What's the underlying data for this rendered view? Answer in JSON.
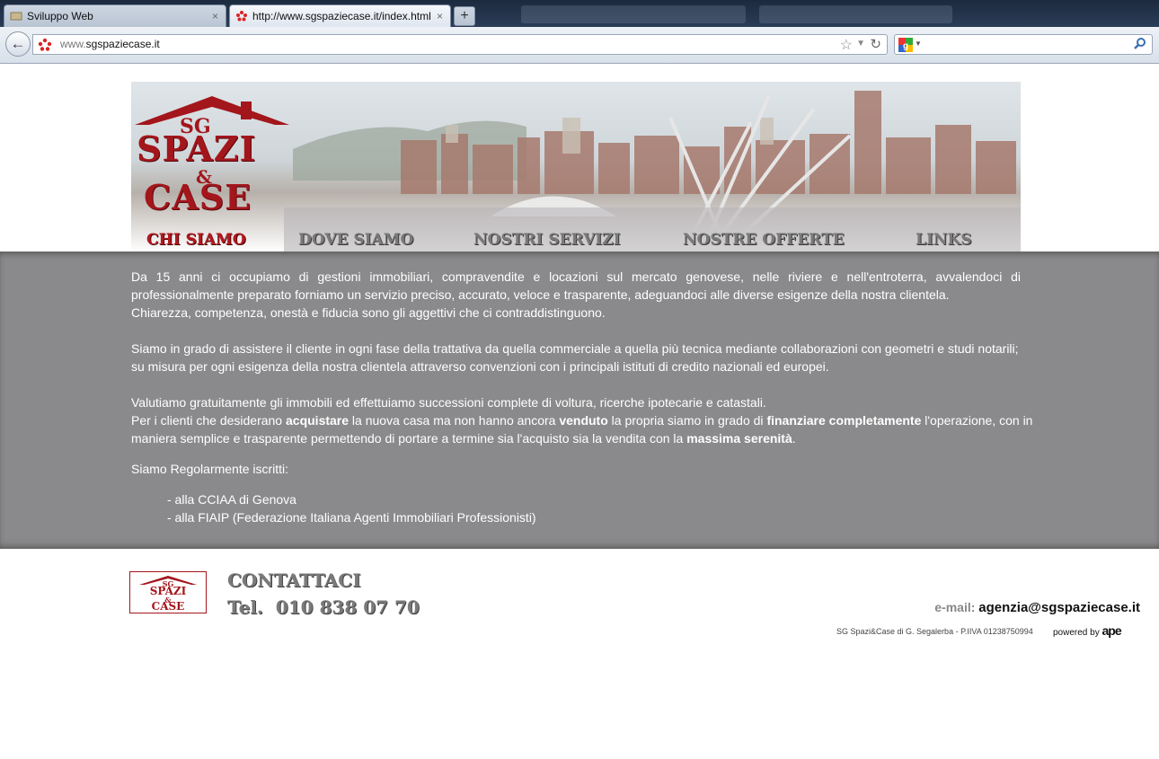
{
  "browser": {
    "tabs": [
      {
        "title": "Sviluppo Web",
        "active": false
      },
      {
        "title": "http://www.sgspaziecase.it/index.html",
        "active": true
      }
    ],
    "new_tab": "+",
    "close_glyph": "×",
    "url_prefix": "www.",
    "url_host": "sgspaziecase.it",
    "search_placeholder": ""
  },
  "header": {
    "logo": {
      "sg": "SG",
      "spazi": "SPAZI",
      "amp": "&",
      "case": "CASE"
    }
  },
  "menu": {
    "items": [
      "CHI SIAMO",
      "DOVE SIAMO",
      "NOSTRI SERVIZI",
      "NOSTRE OFFERTE",
      "LINKS"
    ]
  },
  "content": {
    "p1": "Da 15 anni ci occupiamo di gestioni immobiliari, compravendite e locazioni sul mercato genovese, nelle riviere e nell'entroterra, avvalendoci di professionalmente preparato forniamo un servizio preciso, accurato, veloce e trasparente, adeguandoci alle diverse esigenze della nostra clientela.",
    "p1b": "Chiarezza, competenza, onestà e fiducia sono gli aggettivi che ci contraddistinguono.",
    "p2a": "Siamo in grado di assistere il cliente in ogni fase della trattativa da quella commerciale a quella più tecnica mediante collaborazioni con geometri e studi notarili;",
    "p2b": "su misura per ogni esigenza della nostra clientela attraverso convenzioni con i principali istituti di credito nazionali ed europei.",
    "p3a": "Valutiamo gratuitamente gli immobili ed effettuiamo successioni complete di voltura, ricerche ipotecarie e catastali.",
    "p3b": {
      "t1": "Per i clienti che desiderano ",
      "b1": "acquistare",
      "t2": " la nuova casa ma non hanno ancora ",
      "b2": "venduto",
      "t3": " la propria siamo in grado di ",
      "b3": "finanziare completamente",
      "t4": " l'operazione, con in maniera semplice e trasparente permettendo di portare a termine sia l'acquisto sia la vendita con la ",
      "b4": "massima serenità",
      "t5": "."
    },
    "p4": "Siamo Regolarmente iscritti:",
    "list": [
      "- alla CCIAA di Genova",
      "- alla FIAIP (Federazione Italiana Agenti Immobiliari Professionisti)"
    ]
  },
  "footer": {
    "logo": {
      "sg": "SG",
      "spazi": "SPAZI",
      "amp": "&",
      "case": "CASE"
    },
    "contact_title": "CONTATTACI",
    "tel": "Tel.  010 838 07 70",
    "email_label": "e-mail:",
    "email": "agenzia@sgspaziecase.it",
    "company": "SG Spazi&Case di G. Segalerba - P.IIVA 01238750994",
    "powered_by": "powered by",
    "powered_brand": "ape"
  },
  "colors": {
    "brand_red": "#a3161c",
    "content_bg": "#8a8a8c"
  }
}
